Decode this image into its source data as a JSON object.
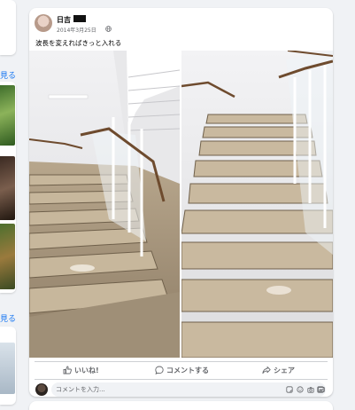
{
  "left_rail": {
    "see_more_1": "見る",
    "see_more_2": "見る"
  },
  "post": {
    "author_name": "日吉",
    "date": "2014年3月25日",
    "privacy_icon": "globe-icon",
    "text": "波長を変えればきっと入れる",
    "photos": [
      {
        "name": "stair-photo-left",
        "subject": "staircase with handrail and glass balustrade"
      },
      {
        "name": "stair-photo-right",
        "subject": "staircase with handrail viewed from below"
      }
    ]
  },
  "actions": {
    "like_label": "いいね!",
    "comment_label": "コメントする",
    "share_label": "シェア",
    "like_icon": "thumbs-up-icon",
    "comment_icon": "comment-icon",
    "share_icon": "share-icon"
  },
  "comment_box": {
    "placeholder": "コメントを入力...",
    "icons": [
      "sticker-icon",
      "emoji-icon",
      "camera-icon",
      "gif-icon",
      "stamp-icon"
    ]
  },
  "colors": {
    "link_blue": "#1877f2",
    "secondary_text": "#65676b",
    "feed_background": "#f0f2f5",
    "card_background": "#ffffff"
  }
}
